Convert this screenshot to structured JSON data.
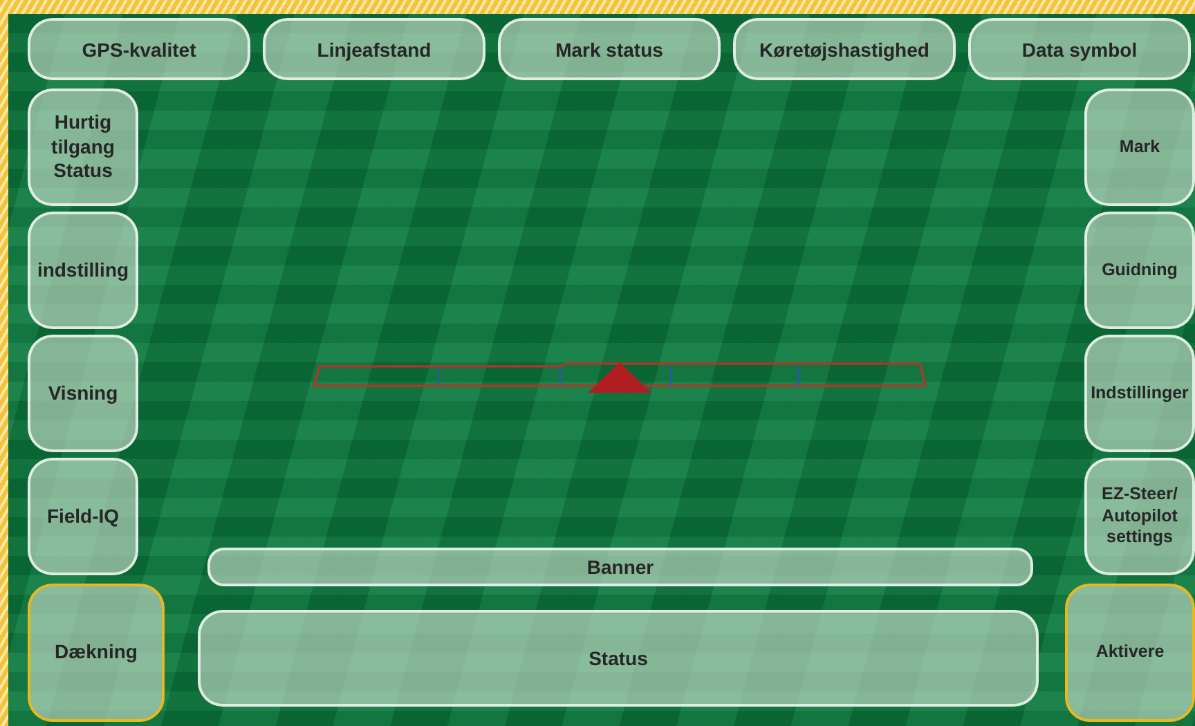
{
  "top_bar": [
    {
      "label": "GPS-kvalitet"
    },
    {
      "label": "Linjeafstand"
    },
    {
      "label": "Mark status"
    },
    {
      "label": "Køretøjshastighed"
    },
    {
      "label": "Data symbol"
    }
  ],
  "left_panel": [
    {
      "label": "Hurtig tilgang Status",
      "highlighted": false
    },
    {
      "label": "indstilling",
      "highlighted": false
    },
    {
      "label": "Visning",
      "highlighted": false
    },
    {
      "label": "Field-IQ",
      "highlighted": false
    },
    {
      "label": "Dækning",
      "highlighted": true
    }
  ],
  "right_panel": [
    {
      "label": "Mark",
      "highlighted": false
    },
    {
      "label": "Guidning",
      "highlighted": false
    },
    {
      "label": "Indstillinger",
      "highlighted": false
    },
    {
      "label": "EZ-Steer/ Autopilot settings",
      "highlighted": false
    },
    {
      "label": "Aktivere",
      "highlighted": true
    }
  ],
  "banner": {
    "label": "Banner"
  },
  "status": {
    "label": "Status"
  }
}
